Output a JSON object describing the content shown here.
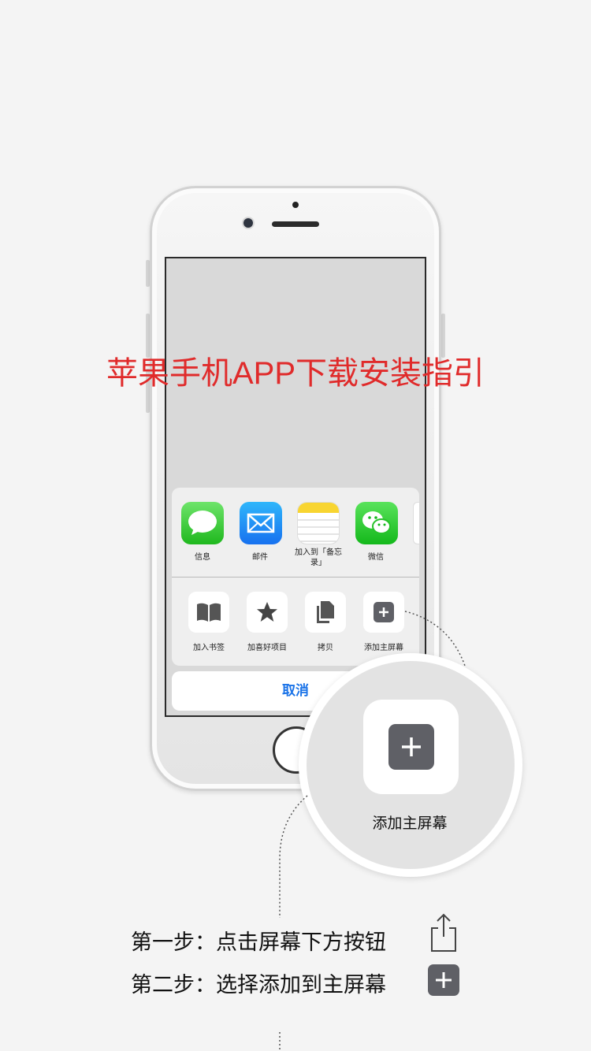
{
  "title": "苹果手机APP下载安装指引",
  "share_apps": [
    {
      "label": "信息",
      "icon": "messages-icon"
    },
    {
      "label": "邮件",
      "icon": "mail-icon"
    },
    {
      "label": "加入到「备忘录」",
      "icon": "notes-icon"
    },
    {
      "label": "微信",
      "icon": "wechat-icon"
    }
  ],
  "share_actions": [
    {
      "label": "加入书签",
      "icon": "book-icon"
    },
    {
      "label": "加喜好项目",
      "icon": "star-icon"
    },
    {
      "label": "拷贝",
      "icon": "copy-icon"
    },
    {
      "label": "添加主屏幕",
      "icon": "add-square-icon"
    }
  ],
  "cancel_label": "取消",
  "zoom_label": "添加主屏幕",
  "steps": [
    {
      "text": "第一步：点击屏幕下方按钮",
      "icon": "share-icon"
    },
    {
      "text": "第二步：选择添加到主屏幕",
      "icon": "add-square-icon"
    }
  ],
  "colors": {
    "title": "#e02b2b",
    "cancel": "#1a73e8",
    "add_icon": "#5f6066"
  }
}
